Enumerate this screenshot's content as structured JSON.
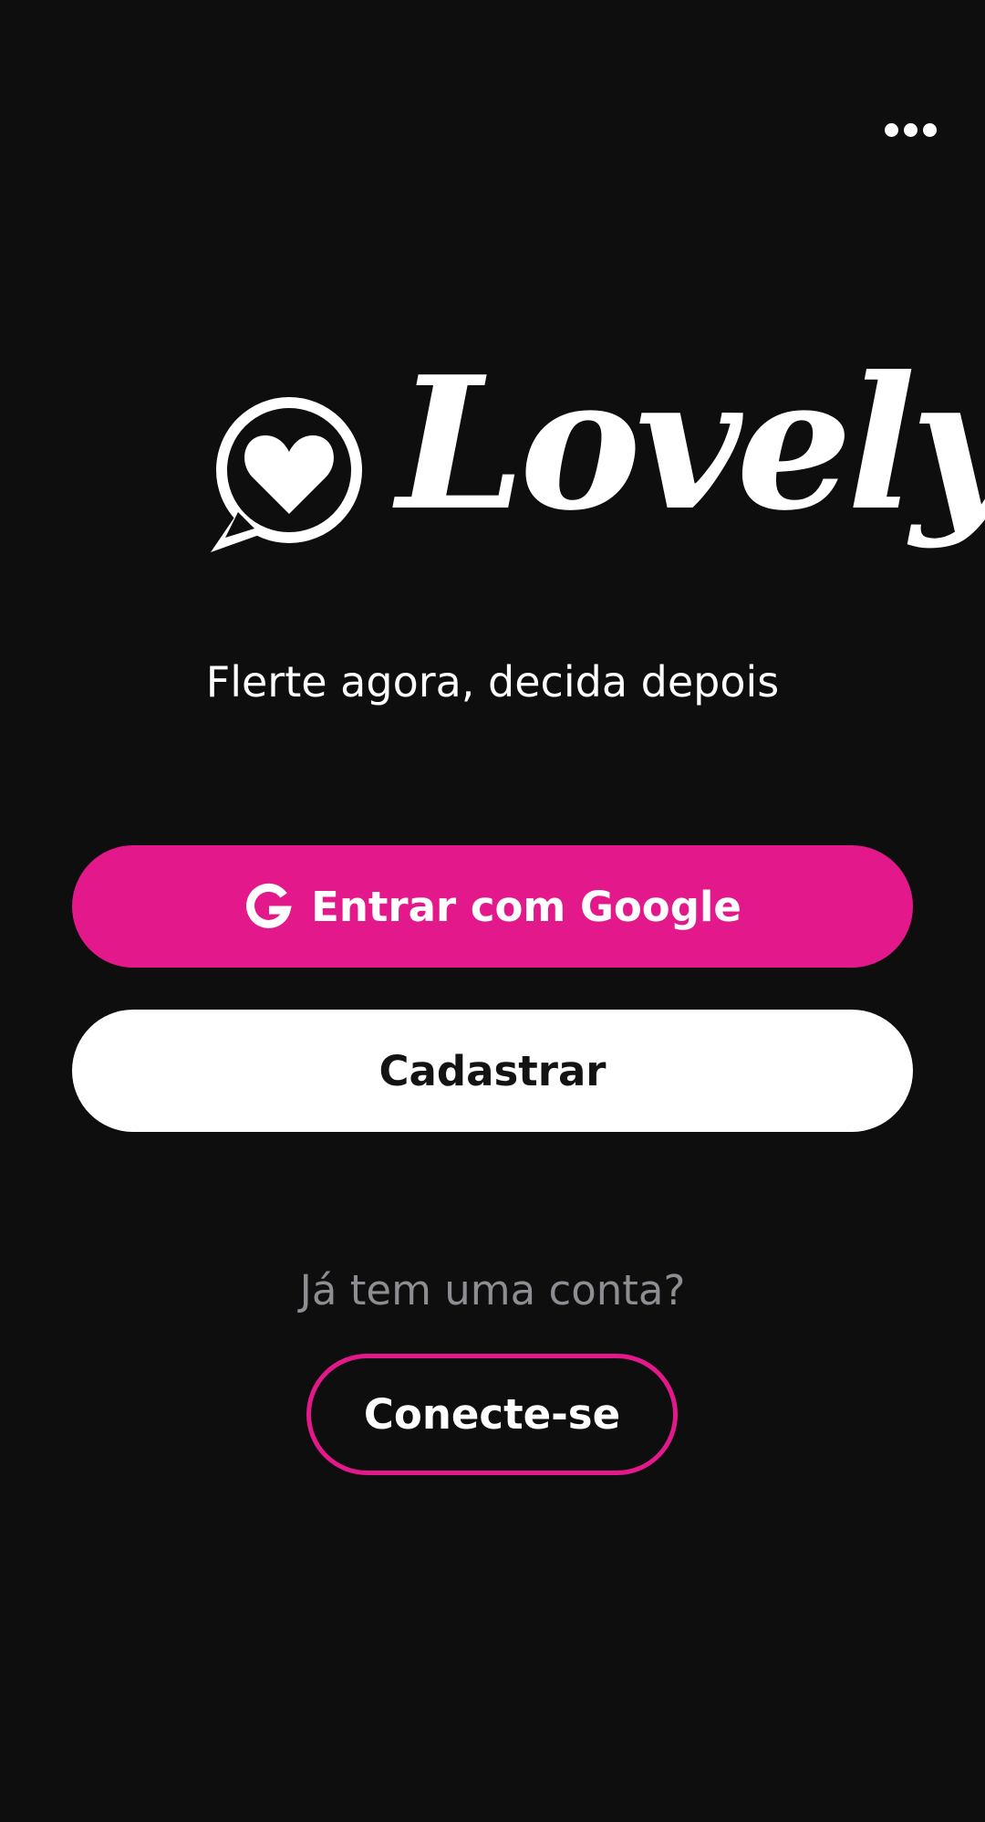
{
  "header": {
    "more_icon": "more-horizontal-icon"
  },
  "logo": {
    "icon": "heart-chat-bubble-icon",
    "text": "Lovely"
  },
  "tagline": "Flerte agora, decida depois",
  "buttons": {
    "google": {
      "label": "Entrar com Google",
      "icon": "google-icon"
    },
    "signup": {
      "label": "Cadastrar"
    },
    "login": {
      "prompt": "Já tem uma conta?",
      "label": "Conecte-se"
    }
  },
  "colors": {
    "background": "#0e0e0f",
    "accent": "#e3198b",
    "text_primary": "#ffffff",
    "text_muted": "#8e8e92"
  }
}
